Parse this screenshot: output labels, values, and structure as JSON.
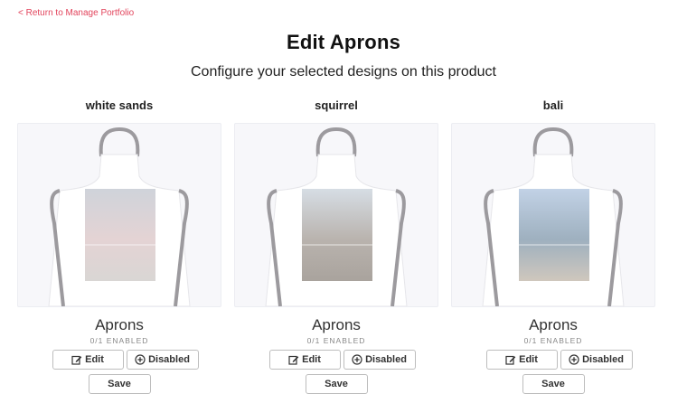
{
  "nav": {
    "back_label": "< Return to Manage Portfolio"
  },
  "header": {
    "title": "Edit Aprons",
    "subtitle": "Configure your selected designs on this product"
  },
  "designs": [
    {
      "name": "white sands",
      "product": "Aprons",
      "enabled": "0/1 ENABLED",
      "edit_label": "Edit",
      "status_label": "Disabled",
      "save_label": "Save",
      "colors": {
        "sky": "#cfd3da",
        "horizon": "#e4d3d4",
        "ground": "#d9d6d4"
      }
    },
    {
      "name": "squirrel",
      "product": "Aprons",
      "enabled": "0/1 ENABLED",
      "edit_label": "Edit",
      "status_label": "Disabled",
      "save_label": "Save",
      "colors": {
        "sky": "#d6dde4",
        "horizon": "#b9b3ae",
        "ground": "#a9a39d"
      }
    },
    {
      "name": "bali",
      "product": "Aprons",
      "enabled": "0/1 ENABLED",
      "edit_label": "Edit",
      "status_label": "Disabled",
      "save_label": "Save",
      "colors": {
        "sky": "#c2d2e6",
        "horizon": "#9eb0bf",
        "ground": "#cfc7bd"
      }
    }
  ],
  "theme": {
    "link": "#e2445c",
    "apron_strap": "#9c9a9e",
    "apron_body": "#ffffff"
  }
}
